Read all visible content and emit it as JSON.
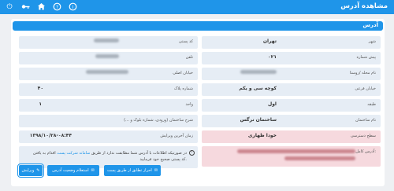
{
  "header": {
    "title": "مشاهده آدرس",
    "icons": [
      "power-icon",
      "key-icon",
      "home-icon",
      "help-icon",
      "info-icon"
    ]
  },
  "card": {
    "title": "آدرس"
  },
  "right_fields": [
    {
      "label": "شهر",
      "value": "تهران"
    },
    {
      "label": "پیش شماره",
      "value": "۰۲۱"
    },
    {
      "label": "نام محله /روستا",
      "value": ""
    },
    {
      "label": "خیابان فرعی",
      "value": "کوچه سی و یکم"
    },
    {
      "label": "طبقه",
      "value": "اول"
    },
    {
      "label": "نام ساختمان",
      "value": "ساختمان نرگس"
    },
    {
      "label": "سطح دسترسی",
      "value": "خودا ظهاری"
    },
    {
      "label": "آدرس کامل:",
      "value": ""
    }
  ],
  "left_fields": [
    {
      "label": "کد پستی",
      "value": ""
    },
    {
      "label": "تلفن",
      "value": ""
    },
    {
      "label": "خیابان اصلی",
      "value": ""
    },
    {
      "label": "شماره پلاک",
      "value": "۴۰"
    },
    {
      "label": "واحد",
      "value": "۱"
    },
    {
      "label": "شرح ساختمان (ورودی، شماره بلوک و ...)",
      "value": ""
    },
    {
      "label": "زمان آخرین ویرایش",
      "value": "۱۳۹۸/۱۰/۲۸-۰۸:۴۴"
    }
  ],
  "notice": {
    "text": "در صورتیکه اطلاعات با آدرس شما مطابقت ندارد از طریق",
    "link": "سامانه شرکت پست",
    "text2": "اقدام به یافتن کد پستی صحیح خود فرمایید."
  },
  "buttons": [
    {
      "label": "ویرایش",
      "icon": "edit-icon"
    },
    {
      "label": "استعلام وضعیت آدرس",
      "icon": "envelope-icon"
    },
    {
      "label": "احراز تطابق از طریق پست",
      "icon": "envelope-icon"
    }
  ]
}
